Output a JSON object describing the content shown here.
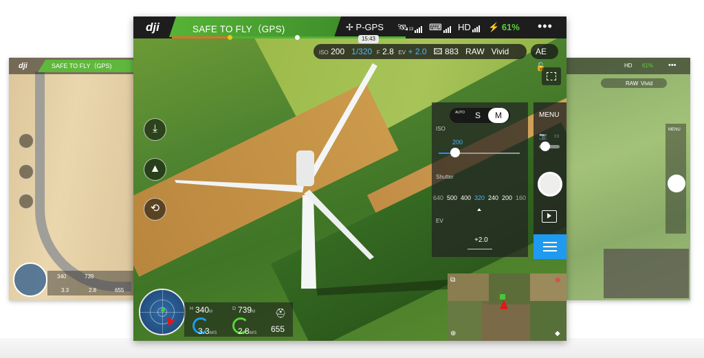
{
  "app": {
    "logo": "dji"
  },
  "status": {
    "safe_label": "SAFE TO FLY（GPS)",
    "flight_mode": "P-GPS",
    "time": "15:43",
    "gps_sats": "13",
    "hd_label": "HD",
    "battery_pct": "61%",
    "more": "•••"
  },
  "exposure": {
    "iso_label": "ISO",
    "iso": "200",
    "shutter": "1/320",
    "f_label": "F",
    "aperture": "2.8",
    "ev_label": "EV",
    "ev": "+ 2.0",
    "shots": "883",
    "format": "RAW",
    "color": "Vivid",
    "ae": "AE"
  },
  "camera_panel": {
    "modes": [
      "AUTO",
      "S",
      "M"
    ],
    "selected_mode": "M",
    "iso_section": "ISO",
    "iso_value": "200",
    "shutter_section": "Shutter",
    "shutter_values": [
      "640",
      "500",
      "400",
      "320",
      "240",
      "200",
      "160"
    ],
    "shutter_selected": "320",
    "ev_section": "EV",
    "ev_value": "+2.0"
  },
  "right_col": {
    "menu": "MENU"
  },
  "telemetry": {
    "h_label": "H",
    "height": "340",
    "height_unit": "M",
    "d_label": "D",
    "distance": "739",
    "distance_unit": "M",
    "hs": "3.3",
    "hs_unit": "M/S",
    "vs": "2.8",
    "vs_unit": "M/S",
    "battery_time": "655"
  },
  "left_side": {
    "safe_label": "SAFE TO FLY（GPS)",
    "height": "340",
    "distance": "739",
    "hs": "3.3",
    "vs": "2.8",
    "battery_time": "655"
  },
  "right_side": {
    "hd_label": "HD",
    "battery_pct": "61%",
    "format": "RAW",
    "color": "Vivid",
    "menu": "MENU"
  },
  "colors": {
    "safe_green": "#56b436",
    "accent_blue": "#1e9bf0",
    "battery_green": "#5bd23c",
    "home_marker": "#47c83a",
    "aircraft_arrow": "#e01818"
  }
}
